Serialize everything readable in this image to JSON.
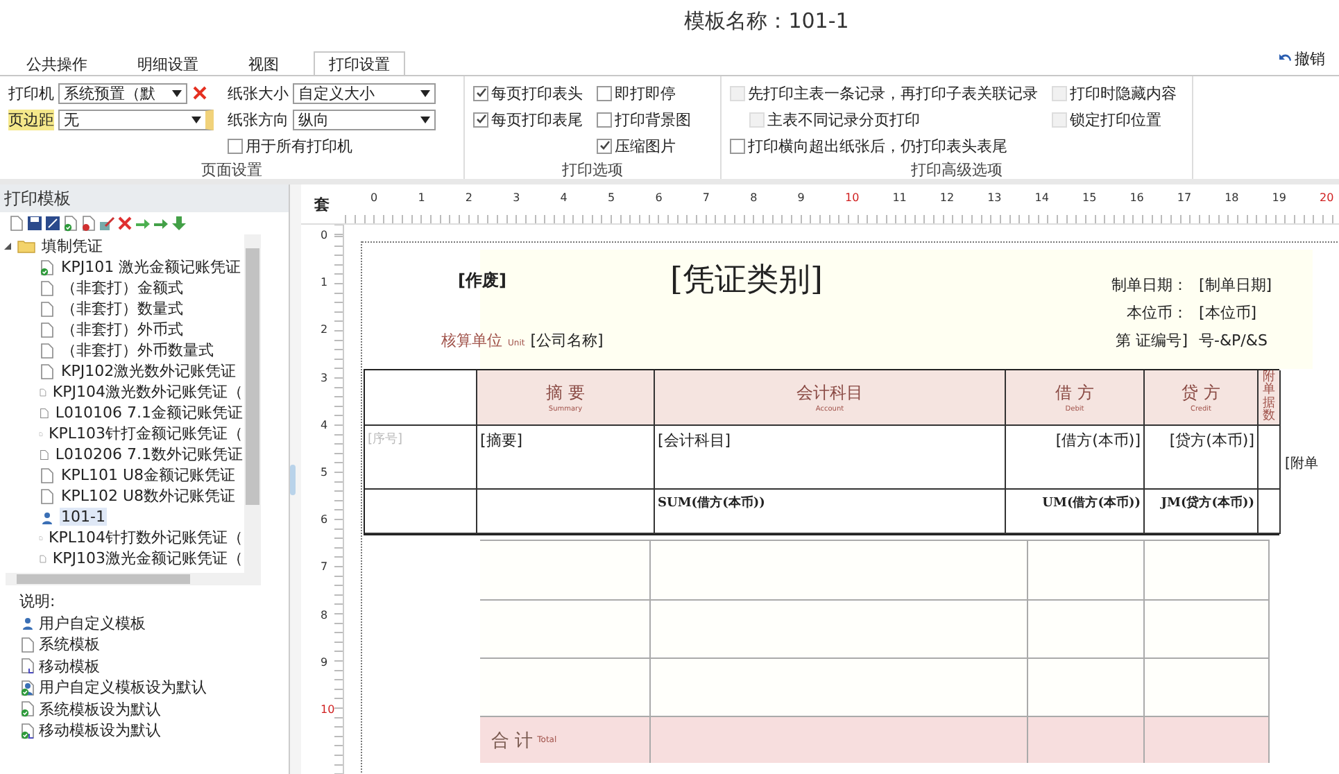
{
  "window": {
    "title": "模板名称：101-1"
  },
  "tabs": [
    {
      "label": "公共操作",
      "selected": false
    },
    {
      "label": "明细设置",
      "selected": false
    },
    {
      "label": "视图",
      "selected": false
    },
    {
      "label": "打印设置",
      "selected": true
    }
  ],
  "undo_button": {
    "label": "撤销"
  },
  "page_setup": {
    "caption": "页面设置",
    "printer": {
      "label": "打印机",
      "value": "系统预置（默"
    },
    "margin": {
      "label": "页边距",
      "value": "无"
    },
    "paper_size": {
      "label": "纸张大小",
      "value": "自定义大小"
    },
    "orientation": {
      "label": "纸张方向",
      "value": "纵向"
    },
    "all_printers": {
      "label": "用于所有打印机",
      "checked": false
    }
  },
  "print_options": {
    "caption": "打印选项",
    "checkboxes": [
      {
        "label": "每页打印表头",
        "checked": true
      },
      {
        "label": "每页打印表尾",
        "checked": true
      },
      {
        "label": "即打即停",
        "checked": false
      },
      {
        "label": "打印背景图",
        "checked": false
      },
      {
        "label": "压缩图片",
        "checked": true
      }
    ]
  },
  "advanced_options": {
    "caption": "打印高级选项",
    "checkboxes": [
      {
        "label": "先打印主表一条记录，再打印子表关联记录",
        "checked": false,
        "disabled": true
      },
      {
        "label": "主表不同记录分页打印",
        "checked": false,
        "disabled": true
      },
      {
        "label": "打印横向超出纸张后，仍打印表头表尾",
        "checked": false,
        "disabled": false
      },
      {
        "label": "打印时隐藏内容",
        "checked": false,
        "disabled": true
      },
      {
        "label": "锁定打印位置",
        "checked": false,
        "disabled": true
      }
    ]
  },
  "template_panel": {
    "title": "打印模板",
    "tree": {
      "label": "填制凭证",
      "expanded": true,
      "children": [
        {
          "label": "KPJ101 激光金额记账凭证",
          "kind": "default",
          "selected": false
        },
        {
          "label": "（非套打）金额式",
          "kind": "system",
          "selected": false
        },
        {
          "label": "（非套打）数量式",
          "kind": "system",
          "selected": false
        },
        {
          "label": "（非套打）外币式",
          "kind": "system",
          "selected": false
        },
        {
          "label": "（非套打）外币数量式",
          "kind": "system",
          "selected": false
        },
        {
          "label": "KPJ102激光数外记账凭证",
          "kind": "system",
          "selected": false
        },
        {
          "label": "KPJ104激光数外记账凭证（",
          "kind": "system",
          "selected": false
        },
        {
          "label": "L010106 7.1金额记账凭证",
          "kind": "system",
          "selected": false
        },
        {
          "label": "KPL103针打金额记账凭证（",
          "kind": "system",
          "selected": false
        },
        {
          "label": "L010206 7.1数外记账凭证",
          "kind": "system",
          "selected": false
        },
        {
          "label": "KPL101 U8金额记账凭证",
          "kind": "system",
          "selected": false
        },
        {
          "label": "KPL102 U8数外记账凭证",
          "kind": "system",
          "selected": false
        },
        {
          "label": "101-1",
          "kind": "user",
          "selected": true
        },
        {
          "label": "KPL104针打数外记账凭证（",
          "kind": "system",
          "selected": false
        },
        {
          "label": "KPJ103激光金额记账凭证（",
          "kind": "system",
          "selected": false
        }
      ]
    },
    "legend": {
      "title": "说明:",
      "items": [
        {
          "label": "用户自定义模板",
          "kind": "user"
        },
        {
          "label": "系统模板",
          "kind": "system"
        },
        {
          "label": "移动模板",
          "kind": "mobile"
        },
        {
          "label": "用户自定义模板设为默认",
          "kind": "user_default"
        },
        {
          "label": "系统模板设为默认",
          "kind": "system_default"
        },
        {
          "label": "移动模板设为默认",
          "kind": "mobile_default"
        }
      ]
    }
  },
  "designer": {
    "corner": "套",
    "ruler_x": [
      {
        "label": "0",
        "major": false
      },
      {
        "label": "1",
        "major": false
      },
      {
        "label": "2",
        "major": false
      },
      {
        "label": "3",
        "major": false
      },
      {
        "label": "4",
        "major": false
      },
      {
        "label": "5",
        "major": false
      },
      {
        "label": "6",
        "major": false
      },
      {
        "label": "7",
        "major": false
      },
      {
        "label": "8",
        "major": false
      },
      {
        "label": "9",
        "major": false
      },
      {
        "label": "10",
        "major": true
      },
      {
        "label": "11",
        "major": false
      },
      {
        "label": "12",
        "major": false
      },
      {
        "label": "13",
        "major": false
      },
      {
        "label": "14",
        "major": false
      },
      {
        "label": "15",
        "major": false
      },
      {
        "label": "16",
        "major": false
      },
      {
        "label": "17",
        "major": false
      },
      {
        "label": "18",
        "major": false
      },
      {
        "label": "19",
        "major": false
      },
      {
        "label": "20",
        "major": true
      }
    ],
    "ruler_y": [
      {
        "label": "0",
        "major": false
      },
      {
        "label": "1",
        "major": false
      },
      {
        "label": "2",
        "major": false
      },
      {
        "label": "3",
        "major": false
      },
      {
        "label": "4",
        "major": false
      },
      {
        "label": "5",
        "major": false
      },
      {
        "label": "6",
        "major": false
      },
      {
        "label": "7",
        "major": false
      },
      {
        "label": "8",
        "major": false
      },
      {
        "label": "9",
        "major": false
      },
      {
        "label": "10",
        "major": true
      }
    ],
    "void_label": "[作废]",
    "voucher_type": "[凭证类别]",
    "fields": [
      {
        "label": "制单日期：",
        "value": "[制单日期]"
      },
      {
        "label": "本位币：",
        "value": "[本位币]"
      },
      {
        "label": "第 证编号]",
        "value": "号-&P/&S"
      }
    ],
    "unit": {
      "label": "核算单位",
      "sublabel": "Unit",
      "value": "[公司名称]"
    },
    "columns": [
      {
        "label": "摘 要",
        "sublabel": "Summary"
      },
      {
        "label": "会计科目",
        "sublabel": "Account"
      },
      {
        "label": "借 方",
        "sublabel": "Debit"
      },
      {
        "label": "贷 方",
        "sublabel": "Credit"
      }
    ],
    "attachments_label": "附单据数",
    "row_number": "[序号]",
    "rows": [
      [
        "[摘要]",
        "[会计科目]",
        "[借方(本币)]",
        "[贷方(本币)]"
      ],
      [
        "",
        "SUM(借方(本币))",
        "UM(借方(本币))",
        "JM(贷方(本币))"
      ]
    ],
    "side_label": "[附单",
    "total": {
      "label": "合 计",
      "sublabel": "Total"
    }
  }
}
